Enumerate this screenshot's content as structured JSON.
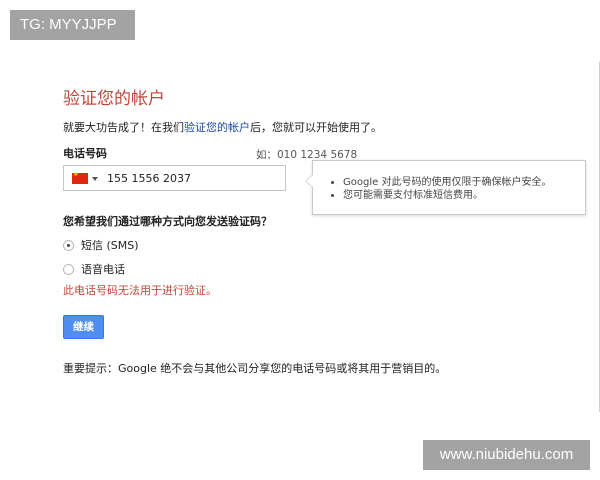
{
  "watermark": {
    "top_left": "TG: MYYJJPP",
    "bottom_right": "www.niubidehu.com"
  },
  "page": {
    "title": "验证您的帐户",
    "intro_before": "就要大功告成了！在我们",
    "intro_link": "验证您的帐户",
    "intro_after": "后，您就可以开始使用了。"
  },
  "phone": {
    "label": "电话号码",
    "example": "如：010 1234 5678",
    "value": "155 1556 2037",
    "country_icon": "china-flag-icon"
  },
  "tooltip": {
    "items": [
      "Google 对此号码的使用仅限于确保帐户安全。",
      "您可能需要支付标准短信费用。"
    ]
  },
  "verification": {
    "question": "您希望我们通过哪种方式向您发送验证码？",
    "options": [
      {
        "label": "短信 (SMS)",
        "checked": true
      },
      {
        "label": "语音电话",
        "checked": false
      }
    ],
    "error": "此电话号码无法用于进行验证。"
  },
  "actions": {
    "continue_label": "继续"
  },
  "notice": "重要提示：Google 绝不会与其他公司分享您的电话号码或将其用于营销目的。",
  "colors": {
    "title": "#c1453a",
    "link": "#1a49a6",
    "button": "#4d8ef0",
    "error": "#c1453a"
  }
}
